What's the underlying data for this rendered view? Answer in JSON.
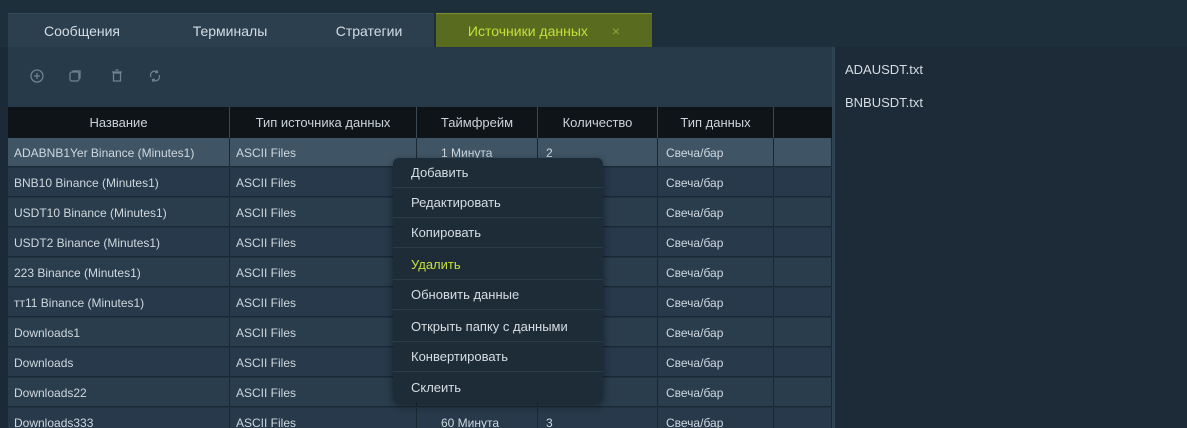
{
  "tabs": [
    {
      "label": "Сообщения"
    },
    {
      "label": "Терминалы"
    },
    {
      "label": "Стратегии"
    },
    {
      "label": "Источники данных",
      "close": "×"
    }
  ],
  "toolbar": {
    "icons": [
      "add-icon",
      "copy-icon",
      "delete-icon",
      "refresh-icon"
    ]
  },
  "table": {
    "columns": [
      "Название",
      "Тип источника данных",
      "Таймфрейм",
      "Количество",
      "Тип данных",
      ""
    ],
    "rows": [
      {
        "name": "ADABNB1Yer Binance (Minutes1)",
        "source": "ASCII Files",
        "timeframe": "1 Минута",
        "count": "2",
        "dtype": "Свеча/бар"
      },
      {
        "name": "BNB10 Binance (Minutes1)",
        "source": "ASCII Files",
        "timeframe": "",
        "count": "",
        "dtype": "Свеча/бар"
      },
      {
        "name": "USDT10 Binance (Minutes1)",
        "source": "ASCII Files",
        "timeframe": "",
        "count": "",
        "dtype": "Свеча/бар"
      },
      {
        "name": "USDT2 Binance (Minutes1)",
        "source": "ASCII Files",
        "timeframe": "",
        "count": "",
        "dtype": "Свеча/бар"
      },
      {
        "name": "223 Binance (Minutes1)",
        "source": "ASCII Files",
        "timeframe": "",
        "count": "",
        "dtype": "Свеча/бар"
      },
      {
        "name": "тт11 Binance (Minutes1)",
        "source": "ASCII Files",
        "timeframe": "",
        "count": "",
        "dtype": "Свеча/бар"
      },
      {
        "name": "Downloads1",
        "source": "ASCII Files",
        "timeframe": "",
        "count": "",
        "dtype": "Свеча/бар"
      },
      {
        "name": "Downloads",
        "source": "ASCII Files",
        "timeframe": "",
        "count": "",
        "dtype": "Свеча/бар"
      },
      {
        "name": "Downloads22",
        "source": "ASCII Files",
        "timeframe": "",
        "count": "",
        "dtype": "Свеча/бар"
      },
      {
        "name": "Downloads333",
        "source": "ASCII Files",
        "timeframe": "60 Минута",
        "count": "3",
        "dtype": "Свеча/бар"
      }
    ]
  },
  "context_menu": {
    "items": [
      {
        "label": "Добавить"
      },
      {
        "label": "Редактировать"
      },
      {
        "label": "Копировать"
      },
      {
        "label": "Удалить"
      },
      {
        "label": "Обновить данные"
      },
      {
        "label": "Открыть папку с данными"
      },
      {
        "label": "Конвертировать"
      },
      {
        "label": "Склеить"
      }
    ]
  },
  "files": [
    "ADAUSDT.txt",
    "BNBUSDT.txt"
  ],
  "colors": {
    "background": "#1b2a36",
    "active_tab": "#586b1e",
    "accent": "#c6e03a",
    "header": "#0f1418"
  }
}
